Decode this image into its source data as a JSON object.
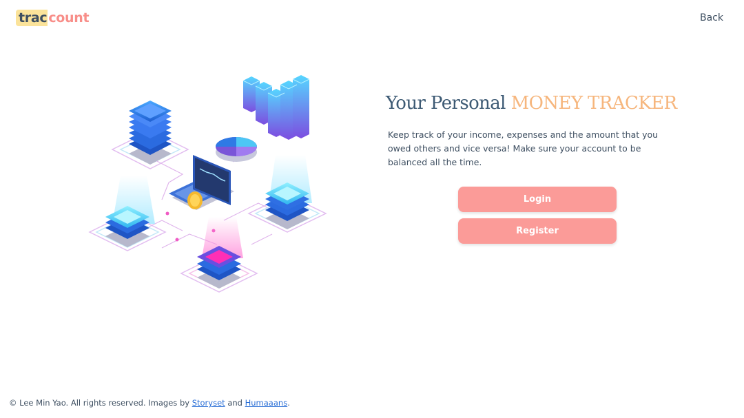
{
  "brand": {
    "part1": "trac",
    "part2": "count"
  },
  "nav": {
    "back_label": "Back"
  },
  "hero": {
    "title_plain": "Your Personal ",
    "title_accent": "MONEY TRACKER",
    "description": "Keep track of your income, expenses and the amount that you owed others and vice versa! Make sure your account to be balanced all the time."
  },
  "actions": {
    "login_label": "Login",
    "register_label": "Register"
  },
  "footer": {
    "copyright": "© Lee Min Yao. All rights reserved. Images by ",
    "link1": "Storyset",
    "joiner": " and ",
    "link2": "Humaaans",
    "end": "."
  },
  "colors": {
    "accent": "#f6b67d",
    "button": "#fb9b98",
    "logo_highlight": "#fbe39a",
    "logo_count": "#f88e89",
    "text": "#3d4e60",
    "link": "#2a6fd6"
  }
}
